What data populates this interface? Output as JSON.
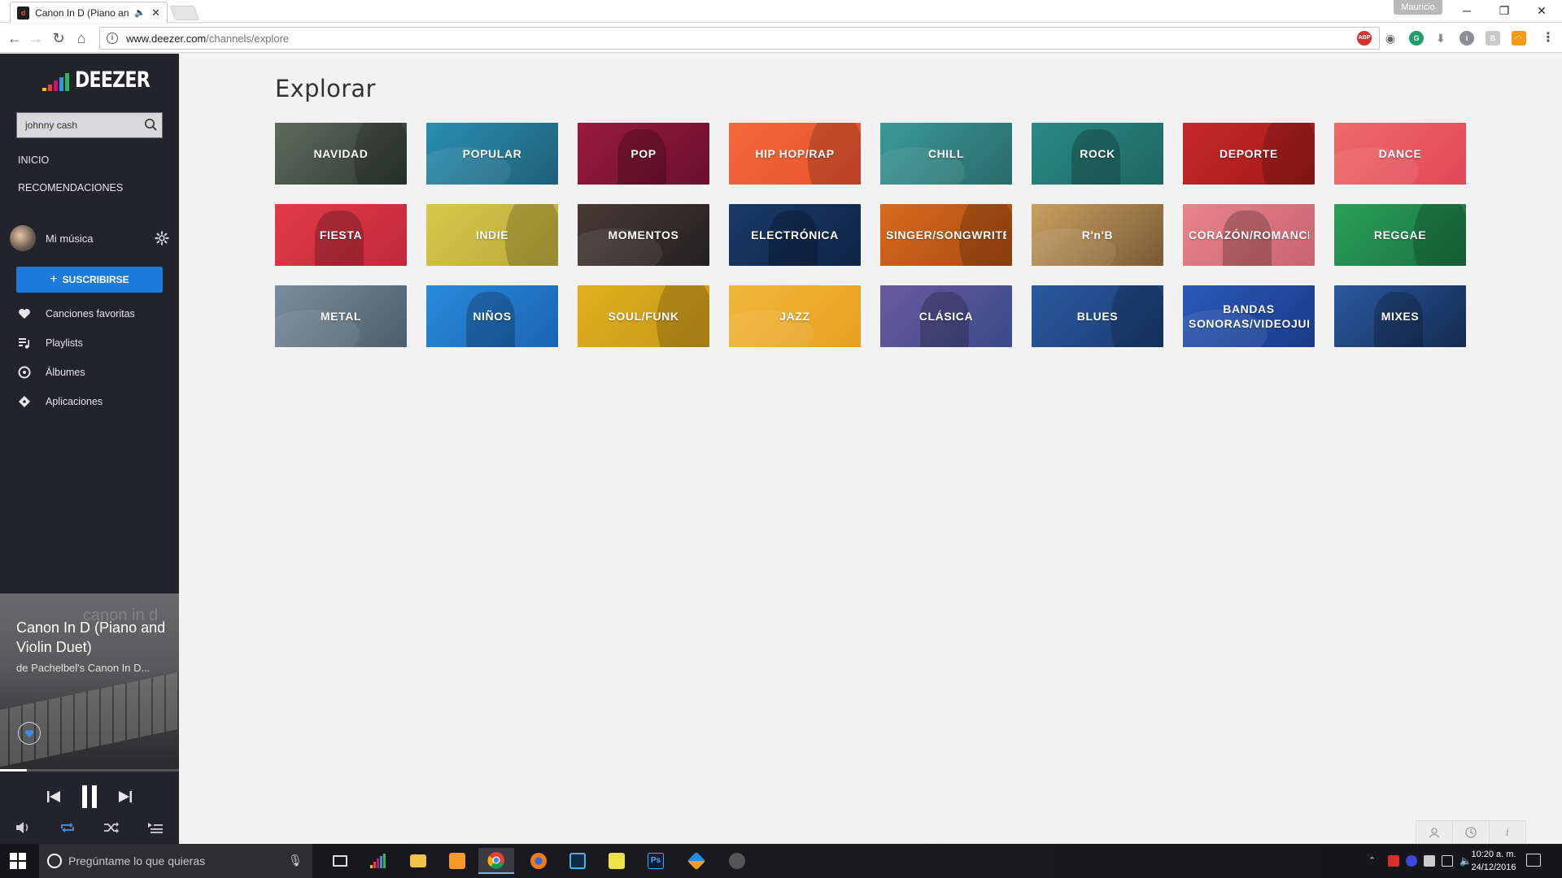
{
  "browser": {
    "tab_title": "Canon In D (Piano and Violin Duet)",
    "profile_name": "Mauricio",
    "url_host": "www.deezer.com",
    "url_path": "/channels/explore"
  },
  "sidebar": {
    "logo": "DEEZER",
    "search_value": "johnny cash",
    "nav": [
      "INICIO",
      "RECOMENDACIONES"
    ],
    "user_label": "Mi música",
    "subscribe_label": "SUSCRIBIRSE",
    "library": [
      {
        "label": "Canciones favoritas",
        "icon": "heart-icon"
      },
      {
        "label": "Playlists",
        "icon": "playlist-icon"
      },
      {
        "label": "Álbumes",
        "icon": "album-icon"
      },
      {
        "label": "Aplicaciones",
        "icon": "apps-icon"
      }
    ]
  },
  "player": {
    "watermark": "canon in d",
    "title": "Canon In D (Piano and Violin Duet)",
    "artist": "de Pachelbel's Canon In D...",
    "progress": 0.15
  },
  "main": {
    "title": "Explorar",
    "channels": [
      {
        "label": "NAVIDAD",
        "colors": [
          "#5e6a5a",
          "#2e3a34"
        ]
      },
      {
        "label": "POPULAR",
        "colors": [
          "#2a8fb0",
          "#1f5f7a"
        ]
      },
      {
        "label": "POP",
        "colors": [
          "#9a1a3e",
          "#6a1030"
        ]
      },
      {
        "label": "HIP HOP/RAP",
        "colors": [
          "#f26a3a",
          "#e8502e"
        ]
      },
      {
        "label": "CHILL",
        "colors": [
          "#3a9a98",
          "#2a6a6a"
        ]
      },
      {
        "label": "ROCK",
        "colors": [
          "#2a8a84",
          "#1e6662"
        ]
      },
      {
        "label": "DEPORTE",
        "colors": [
          "#c62a2a",
          "#a01818"
        ]
      },
      {
        "label": "DANCE",
        "colors": [
          "#f06a6a",
          "#e04858"
        ]
      },
      {
        "label": "FIESTA",
        "colors": [
          "#e23a4a",
          "#c02a3a"
        ]
      },
      {
        "label": "INDIE",
        "colors": [
          "#d8c84a",
          "#b8a83a"
        ]
      },
      {
        "label": "MOMENTOS",
        "colors": [
          "#4a3a34",
          "#222022"
        ]
      },
      {
        "label": "ELECTRÓNICA",
        "colors": [
          "#1a3a6a",
          "#0e2446"
        ]
      },
      {
        "label": "SINGER/SONGWRITER",
        "colors": [
          "#d86a1e",
          "#a84a10"
        ]
      },
      {
        "label": "R'n'B",
        "colors": [
          "#c8a060",
          "#7a5a34"
        ]
      },
      {
        "label": "CORAZÓN/ROMANCE",
        "colors": [
          "#e8848c",
          "#c86470"
        ]
      },
      {
        "label": "REGGAE",
        "colors": [
          "#2aa05a",
          "#1a7040"
        ]
      },
      {
        "label": "METAL",
        "colors": [
          "#7a8e9e",
          "#4a5e6e"
        ]
      },
      {
        "label": "NIÑOS",
        "colors": [
          "#2a8ade",
          "#1a64b0"
        ]
      },
      {
        "label": "SOUL/FUNK",
        "colors": [
          "#e0b020",
          "#c8961a"
        ]
      },
      {
        "label": "JAZZ",
        "colors": [
          "#f0b838",
          "#e8a020"
        ]
      },
      {
        "label": "CLÁSICA",
        "colors": [
          "#6a5a9e",
          "#3a4a8a"
        ]
      },
      {
        "label": "BLUES",
        "colors": [
          "#2a5aa0",
          "#1a3a70"
        ]
      },
      {
        "label": "BANDAS SONORAS/VIDEOJUEGOS",
        "colors": [
          "#2a5ab8",
          "#1a3a88"
        ]
      },
      {
        "label": "MIXES",
        "colors": [
          "#2a5aa0",
          "#142a50"
        ]
      }
    ]
  },
  "taskbar": {
    "search_placeholder": "Pregúntame lo que quieras",
    "time": "10:20 a. m.",
    "date": "24/12/2016"
  },
  "colors": {
    "accent": "#1e7bdc",
    "sidebar_bg": "#23232c",
    "page_bg": "#f2f2f2"
  }
}
